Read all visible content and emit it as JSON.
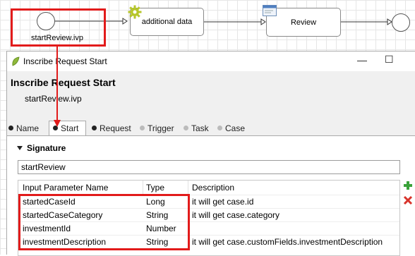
{
  "process": {
    "start_event_label": "startReview.ivp",
    "script_step_label": "additional data",
    "user_task_label": "Review"
  },
  "dialog": {
    "window_title": "Inscribe Request Start",
    "heading": "Inscribe Request Start",
    "subheading": "startReview.ivp",
    "window_buttons": {
      "minimize": "—",
      "maximize": "☐"
    },
    "tabs": [
      {
        "label": "Name",
        "state": "filled"
      },
      {
        "label": "Start",
        "state": "active"
      },
      {
        "label": "Request",
        "state": "filled"
      },
      {
        "label": "Trigger",
        "state": "empty"
      },
      {
        "label": "Task",
        "state": "empty"
      },
      {
        "label": "Case",
        "state": "empty"
      }
    ],
    "signature": {
      "section_label": "Signature",
      "value": "startReview"
    },
    "parameters_table": {
      "columns": [
        "Input Parameter Name",
        "Type",
        "Description"
      ],
      "rows": [
        {
          "name": "startedCaseId",
          "type": "Long",
          "description": "it will get case.id"
        },
        {
          "name": "startedCaseCategory",
          "type": "String",
          "description": "it will get case.category"
        },
        {
          "name": "investmentId",
          "type": "Number",
          "description": ""
        },
        {
          "name": "investmentDescription",
          "type": "String",
          "description": "it will get case.customFields.investmentDescription"
        }
      ]
    }
  },
  "colors": {
    "highlight": "#e21b1b",
    "add_icon": "#3aa23a",
    "remove_icon": "#d8332b",
    "gear_icon": "#b6c62a"
  }
}
